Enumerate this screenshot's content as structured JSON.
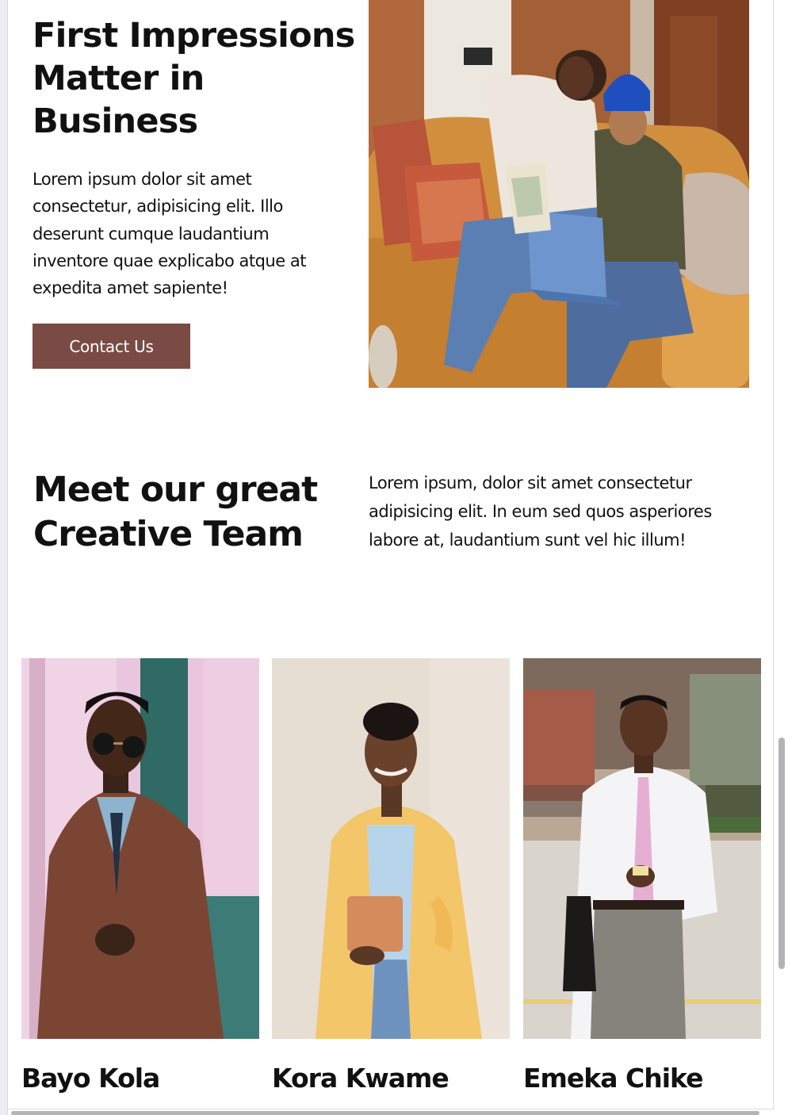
{
  "hero": {
    "title": "First Impressions Matter in Business",
    "text": "Lorem ipsum dolor sit amet consectetur, adipisicing elit. Illo deserunt cumque laudantium inventore quae explicabo atque at expedita amet sapiente!",
    "cta_label": "Contact Us",
    "cta_color": "#7a4b45"
  },
  "team": {
    "title": "Meet our great Creative Team",
    "text": "Lorem ipsum, dolor sit amet consectetur adipisicing elit. In eum sed quos asperiores labore at, laudantium sunt vel hic illum!",
    "members": [
      {
        "name": "Bayo Kola"
      },
      {
        "name": "Kora Kwame"
      },
      {
        "name": "Emeka Chike"
      }
    ]
  }
}
